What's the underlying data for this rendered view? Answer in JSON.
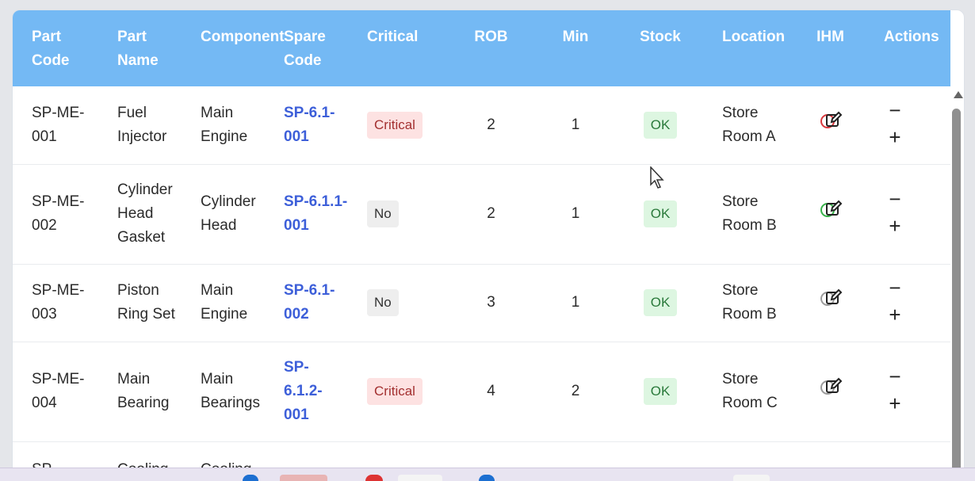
{
  "columns": [
    "Part Code",
    "Part Name",
    "Component",
    "Spare Code",
    "Critical",
    "ROB",
    "Min",
    "Stock",
    "Location",
    "IHM",
    "Actions"
  ],
  "rows": [
    {
      "part_code": "SP-ME-001",
      "part_name": "Fuel Injector",
      "component": "Main Engine",
      "spare_code": "SP-6.1-001",
      "critical": "Critical",
      "rob": "2",
      "min": "1",
      "stock": "OK",
      "location": "Store Room A",
      "ihm_status": "red"
    },
    {
      "part_code": "SP-ME-002",
      "part_name": "Cylinder Head Gasket",
      "component": "Cylinder Head",
      "spare_code": "SP-6.1.1-001",
      "critical": "No",
      "rob": "2",
      "min": "1",
      "stock": "OK",
      "location": "Store Room B",
      "ihm_status": "green"
    },
    {
      "part_code": "SP-ME-003",
      "part_name": "Piston Ring Set",
      "component": "Main Engine",
      "spare_code": "SP-6.1-002",
      "critical": "No",
      "rob": "3",
      "min": "1",
      "stock": "OK",
      "location": "Store Room B",
      "ihm_status": "gray"
    },
    {
      "part_code": "SP-ME-004",
      "part_name": "Main Bearing",
      "component": "Main Bearings",
      "spare_code": "SP-6.1.2-001",
      "critical": "Critical",
      "rob": "4",
      "min": "2",
      "stock": "OK",
      "location": "Store Room C",
      "ihm_status": "gray"
    },
    {
      "part_code": "SP-",
      "part_name": "Cooling",
      "component": "Cooling",
      "spare_code": "",
      "critical": "",
      "rob": "",
      "min": "",
      "stock": "",
      "location": "",
      "ihm_status": ""
    }
  ],
  "actions": {
    "decrease": "−",
    "increase": "+"
  },
  "colors": {
    "header": "#74b9f4",
    "link": "#3d5fd9",
    "critical_bg": "#fde2e2",
    "ok_bg": "#ddf6e1",
    "no_bg": "#eeeeee"
  }
}
